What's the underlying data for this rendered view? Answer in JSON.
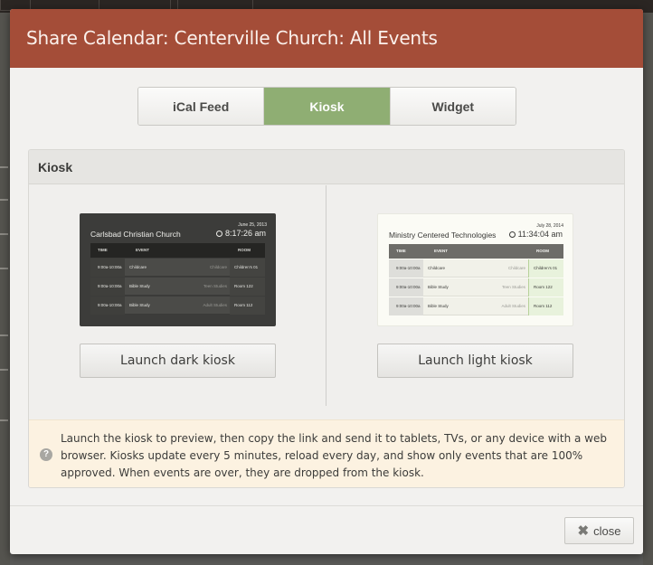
{
  "dialog": {
    "title": "Share Calendar: Centerville Church: All Events",
    "header_color": "#a44d38"
  },
  "tabs": [
    {
      "label": "iCal Feed",
      "active": false
    },
    {
      "label": "Kiosk",
      "active": true
    },
    {
      "label": "Widget",
      "active": false
    }
  ],
  "panel": {
    "title": "Kiosk"
  },
  "dark_kiosk": {
    "date": "June 25, 2013",
    "name": "Carlsbad Christian Church",
    "time": "8:17:26 am",
    "headers": {
      "time": "TIME",
      "event": "EVENT",
      "room": "ROOM"
    },
    "rows": [
      {
        "time": "9:00a-10:00a",
        "event": "Childcare",
        "location": "Childcare",
        "room": "Children's 01"
      },
      {
        "time": "9:00a-10:00a",
        "event": "Bible Study",
        "location": "Teen Studies",
        "room": "Room 122"
      },
      {
        "time": "9:00a-10:00a",
        "event": "Bible Study",
        "location": "Adult Studies",
        "room": "Room 112"
      }
    ],
    "button_label": "Launch dark kiosk"
  },
  "light_kiosk": {
    "date": "July 28, 2014",
    "name": "Ministry Centered Technologies",
    "time": "11:34:04 am",
    "headers": {
      "time": "TIME",
      "event": "EVENT",
      "room": "ROOM"
    },
    "rows": [
      {
        "time": "9:00a-10:00a",
        "event": "Childcare",
        "location": "Childcare",
        "room": "Children's 01"
      },
      {
        "time": "9:00a-10:00a",
        "event": "Bible Study",
        "location": "Teen Studies",
        "room": "Room 122"
      },
      {
        "time": "9:00a-10:00a",
        "event": "Bible Study",
        "location": "Adult Studies",
        "room": "Room 112"
      }
    ],
    "button_label": "Launch light kiosk"
  },
  "note": {
    "text": "Launch the kiosk to preview, then copy the link and send it to tablets, TVs, or any device with a web browser. Kiosks update every 5 minutes, reload every day, and show only events that are 100% approved. When events are over, they are dropped from the kiosk.",
    "icon": "question-icon",
    "icon_glyph": "?"
  },
  "footer": {
    "close_label": "close",
    "close_glyph": "✖"
  }
}
